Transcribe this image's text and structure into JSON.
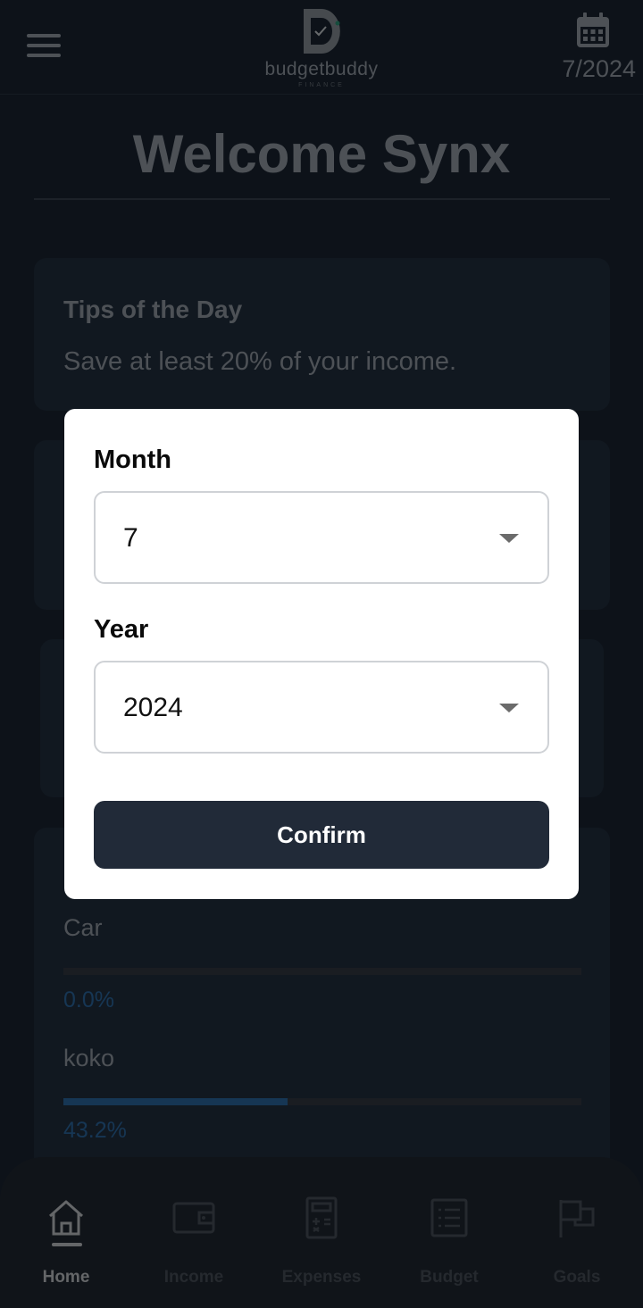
{
  "header": {
    "logo_text": "budgetbuddy",
    "logo_subtext": "FINANCE",
    "selected_period": "7/2024"
  },
  "main": {
    "welcome_title": "Welcome Synx",
    "tips_card": {
      "title": "Tips of the Day",
      "text": "Save at least 20% of your income."
    },
    "goals": [
      {
        "name": "Car",
        "progress_percent": 0.0,
        "progress_label": "0.0%"
      },
      {
        "name": "koko",
        "progress_percent": 43.2,
        "progress_label": "43.2%"
      }
    ]
  },
  "modal": {
    "month_label": "Month",
    "month_value": "7",
    "year_label": "Year",
    "year_value": "2024",
    "confirm_label": "Confirm"
  },
  "bottom_nav": [
    {
      "label": "Home",
      "icon": "home-icon",
      "active": true
    },
    {
      "label": "Income",
      "icon": "wallet-icon",
      "active": false
    },
    {
      "label": "Expenses",
      "icon": "calculator-icon",
      "active": false
    },
    {
      "label": "Budget",
      "icon": "list-icon",
      "active": false
    },
    {
      "label": "Goals",
      "icon": "flag-icon",
      "active": false
    }
  ],
  "colors": {
    "background": "#1a2533",
    "card": "#233040",
    "accent_blue": "#2d6ca8",
    "button_dark": "#212a38",
    "nav_background": "#202833"
  }
}
